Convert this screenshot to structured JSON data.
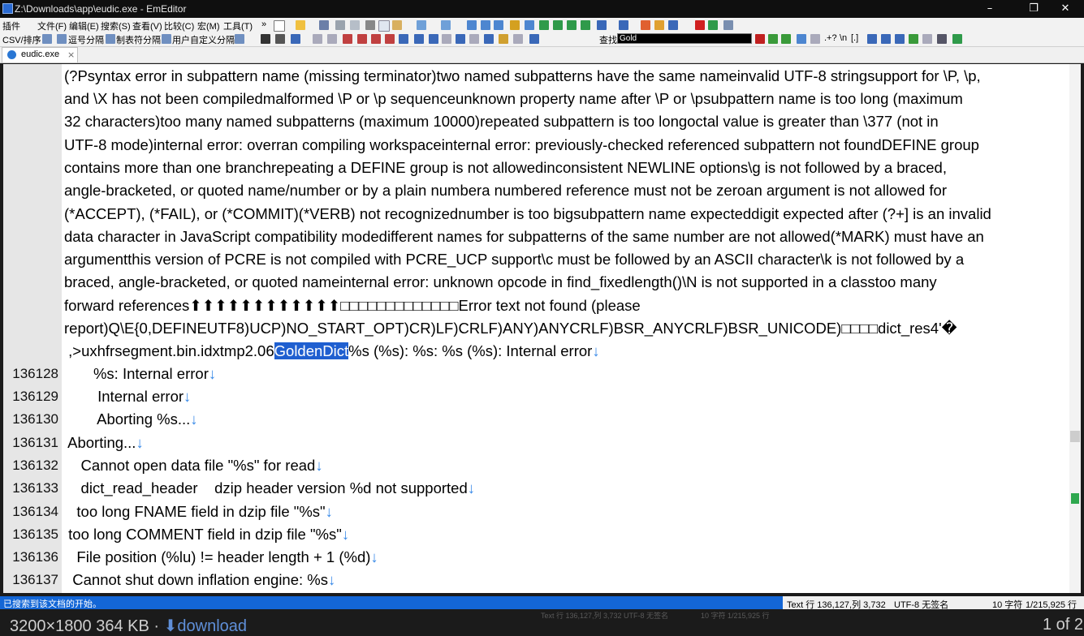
{
  "window": {
    "title": "Z:\\Downloads\\app\\eudic.exe - EmEditor",
    "minimize_glyph": "–",
    "maximize_glyph": "❐",
    "close_glyph": "✕"
  },
  "menubar": {
    "items": [
      "插件",
      "文件(F)",
      "编辑(E)",
      "搜索(S)",
      "查看(V)",
      "比较(C)",
      "宏(M)",
      "工具(T)"
    ],
    "overflow": "»"
  },
  "toolbar2": {
    "csv_label": "CSV/排序",
    "comma_label": "逗号分隔",
    "tab_label": "制表符分隔",
    "custom_label": "用户自定义分隔",
    "find_label": "查找",
    "find_value": "Gold",
    "regex_label": ".+?",
    "word_label": "\\n",
    "case_label": "[.]"
  },
  "tab": {
    "label": "eudic.exe",
    "close": "×"
  },
  "editor": {
    "wrapped_text": [
      "(?Psyntax error in subpattern name (missing terminator)two named subpatterns have the same nameinvalid UTF-8 stringsupport for \\P, \\p,",
      "and \\X has not been compiledmalformed \\P or \\p sequenceunknown property name after \\P or \\psubpattern name is too long (maximum",
      "32 characters)too many named subpatterns (maximum 10000)repeated subpattern is too longoctal value is greater than \\377 (not in",
      "UTF-8 mode)internal error: overran compiling workspaceinternal error: previously-checked referenced subpattern not foundDEFINE group",
      "contains more than one branchrepeating a DEFINE group is not allowedinconsistent NEWLINE options\\g is not followed by a braced,",
      "angle-bracketed, or quoted name/number or by a plain numbera numbered reference must not be zeroan argument is not allowed for",
      "(*ACCEPT), (*FAIL), or (*COMMIT)(*VERB) not recognizednumber is too bigsubpattern name expecteddigit expected after (?+] is an invalid",
      "data character in JavaScript compatibility modedifferent names for subpatterns of the same number are not allowed(*MARK) must have an",
      "argumentthis version of PCRE is not compiled with PCRE_UCP support\\c must be followed by an ASCII character\\k is not followed by a",
      "braced, angle-bracketed, or quoted nameinternal error: unknown opcode in find_fixedlength()\\N is not supported in a classtoo many",
      "forward references⬆⬆⬆⬆⬆⬆⬆⬆⬆⬆⬆⬆□□□□□□□□□□□□□Error text not found (please",
      "report)Q\\E{0,DEFINEUTF8)UCP)NO_START_OPT)CR)LF)CRLF)ANY)ANYCRLF)BSR_ANYCRLF)BSR_UNICODE)□□□□dict_res4'�"
    ],
    "selection_line": {
      "before": " ,>uxhfrsegment.bin.idxtmp2.06",
      "selected": "GoldenDict",
      "after": "%s (%s): %s: %s (%s): Internal error"
    },
    "numbered_lines": [
      {
        "num": "136128",
        "text": "       %s: Internal error"
      },
      {
        "num": "136129",
        "text": "        Internal error"
      },
      {
        "num": "136130",
        "text": "        Aborting %s..."
      },
      {
        "num": "136131",
        "text": " Aborting..."
      },
      {
        "num": "136132",
        "text": "    Cannot open data file \"%s\" for read"
      },
      {
        "num": "136133",
        "text": "    dict_read_header    dzip header version %d not supported"
      },
      {
        "num": "136134",
        "text": "   too long FNAME field in dzip file \"%s\""
      },
      {
        "num": "136135",
        "text": " too long COMMENT field in dzip file \"%s\""
      },
      {
        "num": "136136",
        "text": "   File position (%lu) != header length + 1 (%d)"
      },
      {
        "num": "136137",
        "text": "  Cannot shut down inflation engine: %s"
      }
    ],
    "newline_glyph": "↓"
  },
  "statusbar": {
    "message": "已搜索到该文档的开始。",
    "position": "Text  行 136,127,列 3,732",
    "encoding": "UTF-8 无签名",
    "chars": "10 字符",
    "lines": "1/215,925 行"
  },
  "viewer": {
    "image_info": "3200×1800 364 KB · ",
    "download_arrow": "⬇",
    "download_label": "download",
    "pager": "1 of 2"
  }
}
